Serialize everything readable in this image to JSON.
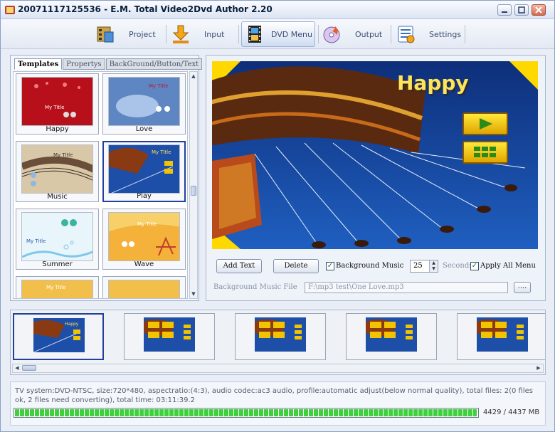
{
  "window": {
    "title": "20071117125536 - E.M. Total Video2Dvd Author 2.20"
  },
  "toolbar": {
    "items": [
      {
        "label": "Project",
        "icon": "film-folder-icon"
      },
      {
        "label": "Input",
        "icon": "download-arrow-icon"
      },
      {
        "label": "DVD Menu",
        "icon": "film-strip-icon",
        "active": true
      },
      {
        "label": "Output",
        "icon": "burn-disc-icon"
      },
      {
        "label": "Settings",
        "icon": "settings-list-icon"
      }
    ]
  },
  "left_panel": {
    "tabs": [
      "Templates",
      "Propertys",
      "BackGround/Button/Text"
    ],
    "active_tab": "Templates",
    "templates": [
      {
        "name": "Happy",
        "thumb_text": "My Title",
        "color": "#b8101a"
      },
      {
        "name": "Love",
        "thumb_text": "My Title",
        "color": "#5d86c2"
      },
      {
        "name": "Music",
        "thumb_text": "My Title",
        "color": "#6a4e3a"
      },
      {
        "name": "Play",
        "thumb_text": "My Title",
        "color": "#1d4ea8",
        "selected": true
      },
      {
        "name": "Summer",
        "thumb_text": "My Title",
        "color": "#c9e7f5"
      },
      {
        "name": "Wave",
        "thumb_text": "My Title",
        "color": "#f0a020"
      },
      {
        "name": "",
        "thumb_text": "My Title",
        "color": "#f2c04a"
      },
      {
        "name": "",
        "thumb_text": "",
        "color": "#f2c04a"
      }
    ]
  },
  "preview": {
    "title": "Happy",
    "accent": "#ffe45a",
    "background": "#123a8e"
  },
  "controls": {
    "add_text_label": "Add Text",
    "delete_label": "Delete",
    "background_music_label": "Background Music",
    "background_music_checked": true,
    "seconds_value": "25",
    "seconds_label": "Seconds",
    "apply_all_menu_label": "Apply All Menu",
    "apply_all_menu_checked": true,
    "bg_music_file_label": "Background Music File",
    "bg_music_file_value": "F:\\mp3 test\\One Love.mp3",
    "browse_label": "...."
  },
  "menu_pages": [
    {
      "title": "Happy",
      "selected": true
    },
    {
      "title": ""
    },
    {
      "title": ""
    },
    {
      "title": ""
    },
    {
      "title": ""
    }
  ],
  "status": {
    "info": "TV system:DVD-NTSC, size:720*480, aspectratio:(4:3), audio codec:ac3 audio, profile:automatic adjust(below normal quality), total files: 2(0 files ok, 2 files need converting), total time: 03:11:39.2",
    "progress_fraction": 0.998,
    "sizes": "4429 / 4437 MB"
  }
}
